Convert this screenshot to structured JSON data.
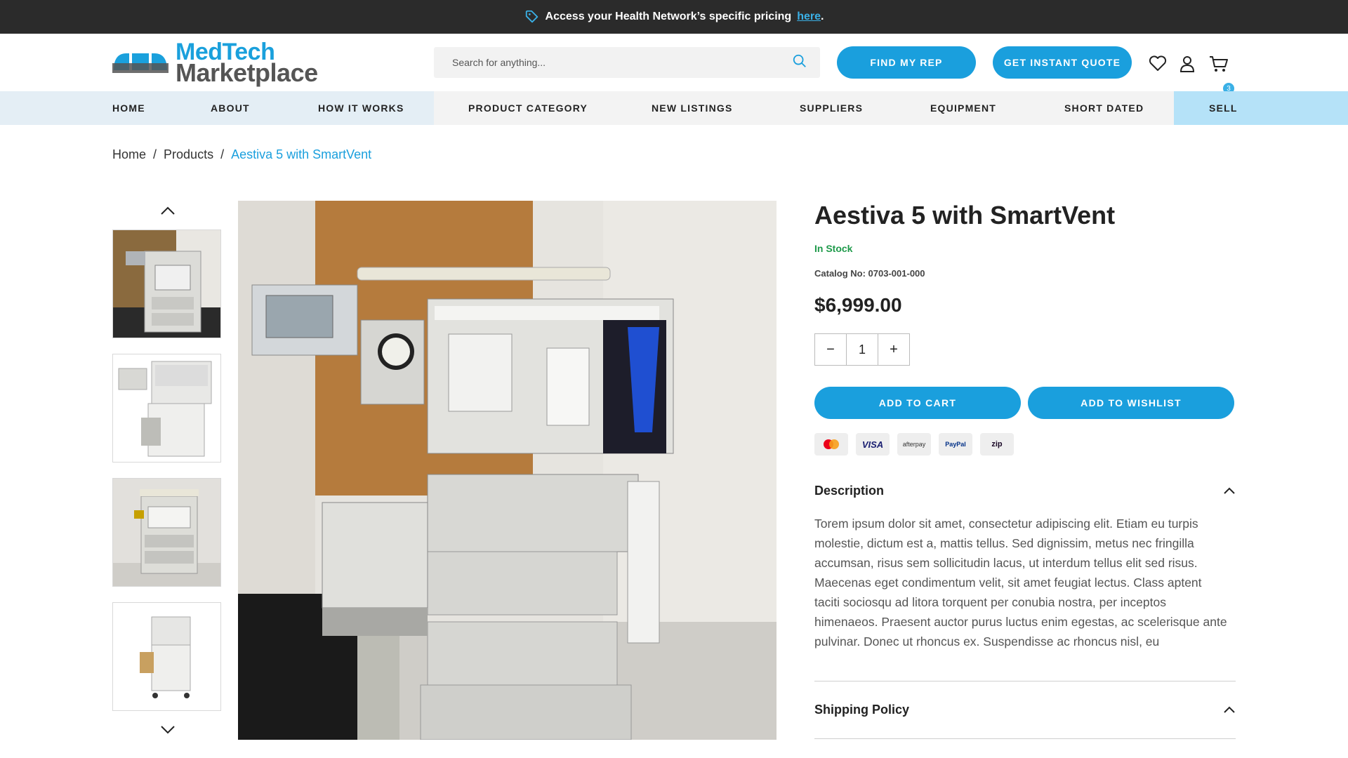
{
  "promo": {
    "text": "Access your Health Network’s specific pricing",
    "link": "here",
    "end": "."
  },
  "logo": {
    "line1": "MedTech",
    "line2": "Marketplace"
  },
  "search": {
    "placeholder": "Search for anything..."
  },
  "header": {
    "find_rep": "FIND MY REP",
    "instant_quote": "GET INSTANT QUOTE",
    "cart_count": "3"
  },
  "nav": {
    "items": [
      "HOME",
      "ABOUT",
      "HOW IT WORKS",
      "PRODUCT CATEGORY",
      "NEW LISTINGS",
      "SUPPLIERS",
      "EQUIPMENT",
      "SHORT DATED",
      "SELL"
    ]
  },
  "breadcrumb": {
    "home": "Home",
    "sep": "/",
    "products": "Products",
    "current": "Aestiva 5 with SmartVent"
  },
  "product": {
    "title": "Aestiva 5 with SmartVent",
    "stock": "In Stock",
    "catalog": "Catalog No: 0703-001-000",
    "price": "$6,999.00",
    "qty": "1",
    "qty_minus": "−",
    "qty_plus": "+",
    "add_to_cart": "ADD TO CART",
    "add_to_wishlist": "ADD TO WISHLIST",
    "payments": [
      "mastercard",
      "VISA",
      "afterpay",
      "PayPal",
      "zip"
    ]
  },
  "description": {
    "title": "Description",
    "body": "Torem ipsum dolor sit amet, consectetur adipiscing elit. Etiam eu turpis molestie, dictum est a, mattis tellus. Sed dignissim, metus nec fringilla accumsan, risus sem sollicitudin lacus, ut interdum tellus elit sed risus. Maecenas eget condimentum velit, sit amet feugiat lectus. Class aptent taciti sociosqu ad litora torquent per conubia nostra, per inceptos himenaeos. Praesent auctor purus luctus enim egestas, ac scelerisque ante pulvinar. Donec ut rhoncus ex. Suspendisse ac rhoncus nisl, eu"
  },
  "shipping": {
    "title": "Shipping Policy"
  },
  "colors": {
    "accent": "#1a9fdd",
    "promo_bg": "#2b2b2b",
    "stock": "#1e9a4a"
  }
}
